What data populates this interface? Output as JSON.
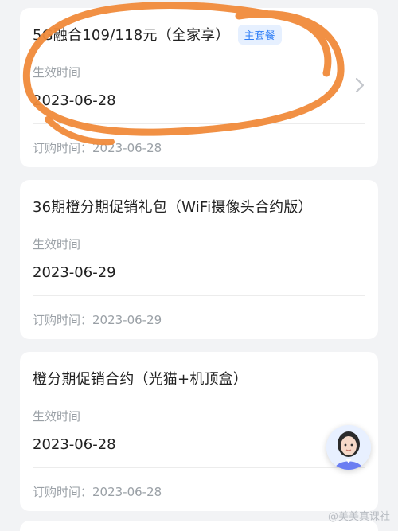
{
  "cards": [
    {
      "title": "5G融合109/118元（全家享）",
      "badge": "主套餐",
      "effective_label": "生效时间",
      "effective_date": "2023-06-28",
      "order_label": "订购时间：2023-06-28"
    },
    {
      "title": "36期橙分期促销礼包（WiFi摄像头合约版）",
      "effective_label": "生效时间",
      "effective_date": "2023-06-29",
      "order_label": "订购时间：2023-06-29"
    },
    {
      "title": "橙分期促销合约（光猫+机顶盒）",
      "effective_label": "生效时间",
      "effective_date": "2023-06-28",
      "order_label": "订购时间：2023-06-28"
    }
  ],
  "watermark": "@美美真课社",
  "colors": {
    "annotation": "#f08a3a",
    "badge_text": "#2d7df6",
    "badge_bg": "#e6f0ff",
    "background": "#f2f3f5"
  },
  "icons": {
    "chevron": "chevron-right-icon",
    "assistant": "assistant-avatar-icon"
  }
}
